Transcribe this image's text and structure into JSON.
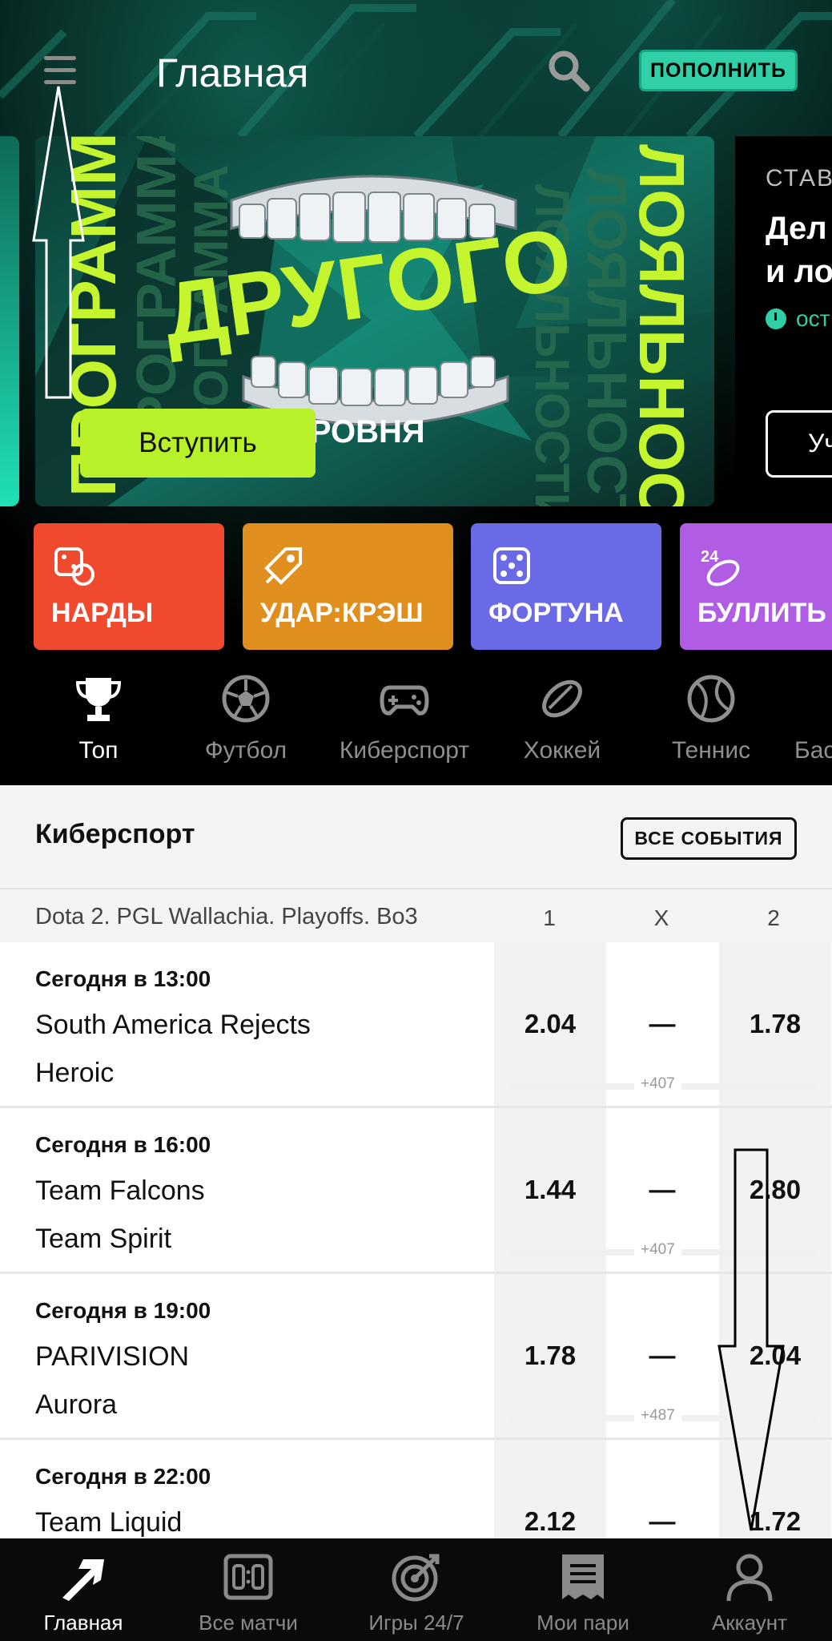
{
  "header": {
    "title": "Главная",
    "deposit_label": "ПОПОЛНИТЬ"
  },
  "banner": {
    "cta_label": "Вступить",
    "level_text": "УРОВНЯ",
    "vertical_left": "ПРОГРАММА",
    "vertical_right": "ЛОЯЛЬНОСТИ",
    "headline": "ДРУГОГО"
  },
  "promo": {
    "kicker": "СТАВ",
    "title_line1": "Дел",
    "title_line2": "и ло",
    "time": "ост",
    "button": "Уч"
  },
  "tiles": [
    {
      "label": "НАРДЫ",
      "color": "#f04a2e",
      "icon": "dice-icon"
    },
    {
      "label": "УДАР:КРЭШ",
      "color": "#e08e1e",
      "icon": "rocket-icon"
    },
    {
      "label": "ФОРТУНА",
      "color": "#6b6ae6",
      "icon": "die-icon"
    },
    {
      "label": "БУЛЛИТЬ",
      "color": "#b05ce4",
      "icon": "puck-24-icon"
    }
  ],
  "sports": [
    {
      "label": "Топ",
      "icon": "trophy-icon",
      "active": true
    },
    {
      "label": "Футбол",
      "icon": "soccer-ball-icon"
    },
    {
      "label": "Киберспорт",
      "icon": "gamepad-icon"
    },
    {
      "label": "Хоккей",
      "icon": "hockey-puck-icon"
    },
    {
      "label": "Теннис",
      "icon": "tennis-ball-icon"
    },
    {
      "label": "Бас",
      "icon": "basketball-icon"
    }
  ],
  "events": {
    "section_title": "Киберспорт",
    "all_events_label": "ВСЕ СОБЫТИЯ",
    "league": "Dota 2. PGL Wallachia. Playoffs. Bo3",
    "col_1": "1",
    "col_x": "X",
    "col_2": "2",
    "matches": [
      {
        "time": "Сегодня в 13:00",
        "team1": "South America Rejects",
        "team2": "Heroic",
        "odd1": "2.04",
        "oddx": "—",
        "odd2": "1.78",
        "more": "+407"
      },
      {
        "time": "Сегодня в 16:00",
        "team1": "Team Falcons",
        "team2": "Team Spirit",
        "odd1": "1.44",
        "oddx": "—",
        "odd2": "2.80",
        "more": "+407"
      },
      {
        "time": "Сегодня в 19:00",
        "team1": "PARIVISION",
        "team2": "Aurora",
        "odd1": "1.78",
        "oddx": "—",
        "odd2": "2.04",
        "more": "+487"
      },
      {
        "time": "Сегодня в 22:00",
        "team1": "Team Liquid",
        "team2": "",
        "odd1": "2.12",
        "oddx": "—",
        "odd2": "1.72",
        "more": ""
      }
    ]
  },
  "nav": [
    {
      "label": "Главная",
      "icon": "arrow-logo-icon",
      "active": true
    },
    {
      "label": "Все матчи",
      "icon": "scoreboard-icon"
    },
    {
      "label": "Игры 24/7",
      "icon": "target-icon"
    },
    {
      "label": "Мои пари",
      "icon": "receipt-icon"
    },
    {
      "label": "Аккаунт",
      "icon": "user-icon"
    }
  ],
  "colors": {
    "accent": "#2fd0a8",
    "banner_lime": "#b8f02a"
  }
}
